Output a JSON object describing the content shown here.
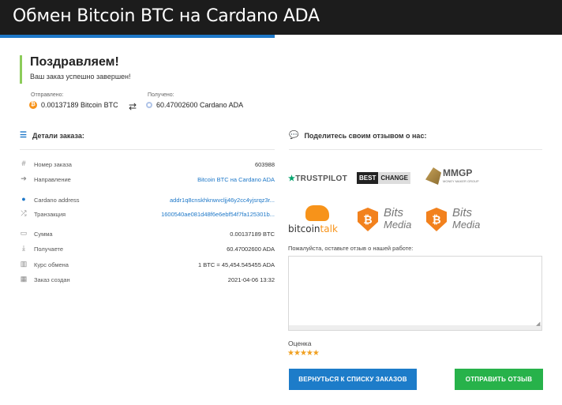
{
  "window": {
    "title": "Обмен Bitcoin BTC на Cardano ADA"
  },
  "congrats": {
    "heading": "Поздравляем!",
    "subtitle": "Ваш заказ успешно завершен!"
  },
  "sent": {
    "label": "Отправлено:",
    "value": "0.00137189 Bitcoin BTC"
  },
  "received": {
    "label": "Получено:",
    "value": "60.47002600 Cardano ADA"
  },
  "details": {
    "heading": "Детали заказа:",
    "rows": [
      {
        "label": "Номер заказа",
        "value": "603988",
        "icon": "hash-icon"
      },
      {
        "label": "Направление",
        "value": "Bitcoin BTC на Cardano ADA",
        "icon": "direction-icon"
      },
      {
        "label": "Cardano address",
        "value": "addr1q8cnskhknwvcljj46y2cc4yjsrqz3r...",
        "icon": "address-icon"
      },
      {
        "label": "Транзакция",
        "value": "1600540ae081d48f6e6ebf54f7fa125301b...",
        "icon": "shuffle-icon"
      },
      {
        "label": "Сумма",
        "value": "0.00137189 BTC",
        "icon": "wallet-icon"
      },
      {
        "label": "Получаете",
        "value": "60.47002600 ADA",
        "icon": "download-icon"
      },
      {
        "label": "Курс обмена",
        "value": "1 BTC = 45,454.545455 ADA",
        "icon": "chart-icon"
      },
      {
        "label": "Заказ создан",
        "value": "2021-04-06 13:32",
        "icon": "calendar-icon"
      }
    ]
  },
  "feedback": {
    "heading": "Поделитесь своим отзывом о нас:",
    "logos": {
      "trustpilot": "TRUSTPILOT",
      "bestchange_1": "BEST",
      "bestchange_2": "CHANGE",
      "mmgp": "MMGP",
      "mmgp_sub": "MONEY MAKER GROUP",
      "bitcointalk_1": "bitcoin",
      "bitcointalk_2": "talk",
      "bits_1": "Bits",
      "bits_2": "Media"
    },
    "review_label": "Пожалуйста, оставьте отзыв о нашей работе:",
    "review_value": "",
    "rating_label": "Оценка",
    "rating": 5
  },
  "buttons": {
    "back": "ВЕРНУТЬСЯ К СПИСКУ ЗАКАЗОВ",
    "send": "ОТПРАВИТЬ ОТЗЫВ"
  },
  "colors": {
    "accent": "#1e78c8",
    "success": "#27b24a",
    "congrats_bar": "#8ccc5a",
    "star": "#f0a020"
  }
}
